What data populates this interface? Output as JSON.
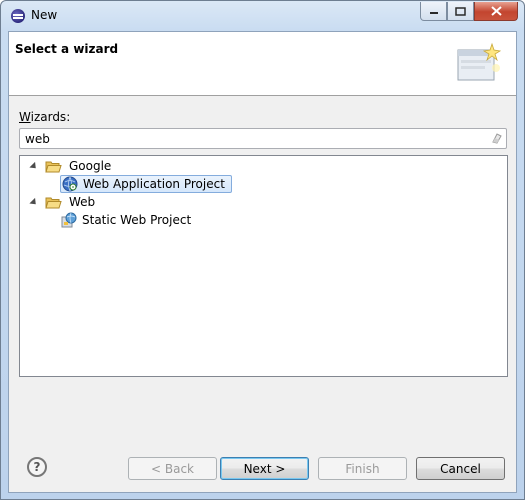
{
  "window": {
    "title": "New"
  },
  "header": {
    "title": "Select a wizard"
  },
  "wizards": {
    "label_mnemonic": "W",
    "label_rest": "izards:",
    "filter_value": "web"
  },
  "tree": {
    "groups": [
      {
        "label": "Google",
        "items": [
          {
            "label": "Web Application Project",
            "selected": true
          }
        ]
      },
      {
        "label": "Web",
        "items": [
          {
            "label": "Static Web Project",
            "selected": false
          }
        ]
      }
    ]
  },
  "buttons": {
    "help": "?",
    "back": "< Back",
    "back_mnemonic": "B",
    "next": "Next >",
    "next_mnemonic": "N",
    "finish": "Finish",
    "finish_mnemonic": "F",
    "cancel": "Cancel"
  },
  "icons": {
    "app": "eclipse-icon",
    "clear": "eraser-icon",
    "folder": "open-folder-icon",
    "gwt": "google-web-app-icon",
    "static_web": "web-project-icon",
    "wizard_banner": "wizard-banner-icon"
  }
}
